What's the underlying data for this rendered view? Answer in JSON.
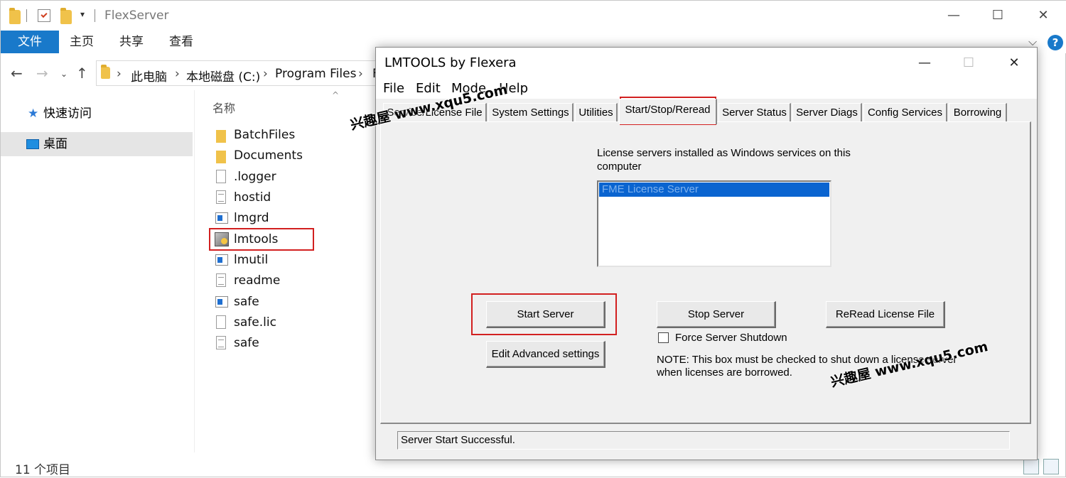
{
  "explorer": {
    "title": "FlexServer",
    "window_controls": {
      "minimize": "—",
      "maximize": "☐",
      "close": "✕"
    },
    "ribbon": {
      "file": "文件",
      "tabs": [
        "主页",
        "共享",
        "查看"
      ],
      "help": "?"
    },
    "breadcrumb": [
      "此电脑",
      "本地磁盘 (C:)",
      "Program Files",
      "F"
    ],
    "nav": {
      "quick_access": "快速访问",
      "desktop": "桌面"
    },
    "column_header": "名称",
    "files": [
      {
        "name": "BatchFiles",
        "icon": "folder-icon"
      },
      {
        "name": "Documents",
        "icon": "folder-icon"
      },
      {
        "name": ".logger",
        "icon": "file-icon"
      },
      {
        "name": "hostid",
        "icon": "text-file-icon"
      },
      {
        "name": "lmgrd",
        "icon": "exe-icon"
      },
      {
        "name": "lmtools",
        "icon": "tool-icon"
      },
      {
        "name": "lmutil",
        "icon": "exe-icon"
      },
      {
        "name": "readme",
        "icon": "text-file-icon"
      },
      {
        "name": "safe",
        "icon": "exe-icon"
      },
      {
        "name": "safe.lic",
        "icon": "file-icon"
      },
      {
        "name": "safe",
        "icon": "text-file-icon"
      }
    ],
    "status": "11 个项目",
    "highlight_color": "#d22020"
  },
  "lmtools": {
    "title": "LMTOOLS by Flexera",
    "menu": [
      "File",
      "Edit",
      "Mode",
      "Help"
    ],
    "tabs": [
      "Service/License File",
      "System Settings",
      "Utilities",
      "Start/Stop/Reread",
      "Server Status",
      "Server Diags",
      "Config Services",
      "Borrowing"
    ],
    "active_tab": "Start/Stop/Reread",
    "services_label": "License servers installed as Windows services on this computer",
    "services": [
      "FME License Server"
    ],
    "buttons": {
      "start": "Start Server",
      "stop": "Stop Server",
      "reread": "ReRead License File",
      "advanced": "Edit Advanced settings"
    },
    "force_shutdown_label": "Force Server Shutdown",
    "force_shutdown_checked": false,
    "note": "NOTE:  This box must be checked to shut down a license server when licenses are borrowed.",
    "status": "Server Start Successful."
  },
  "watermark": "兴趣屋 www.xqu5.com"
}
